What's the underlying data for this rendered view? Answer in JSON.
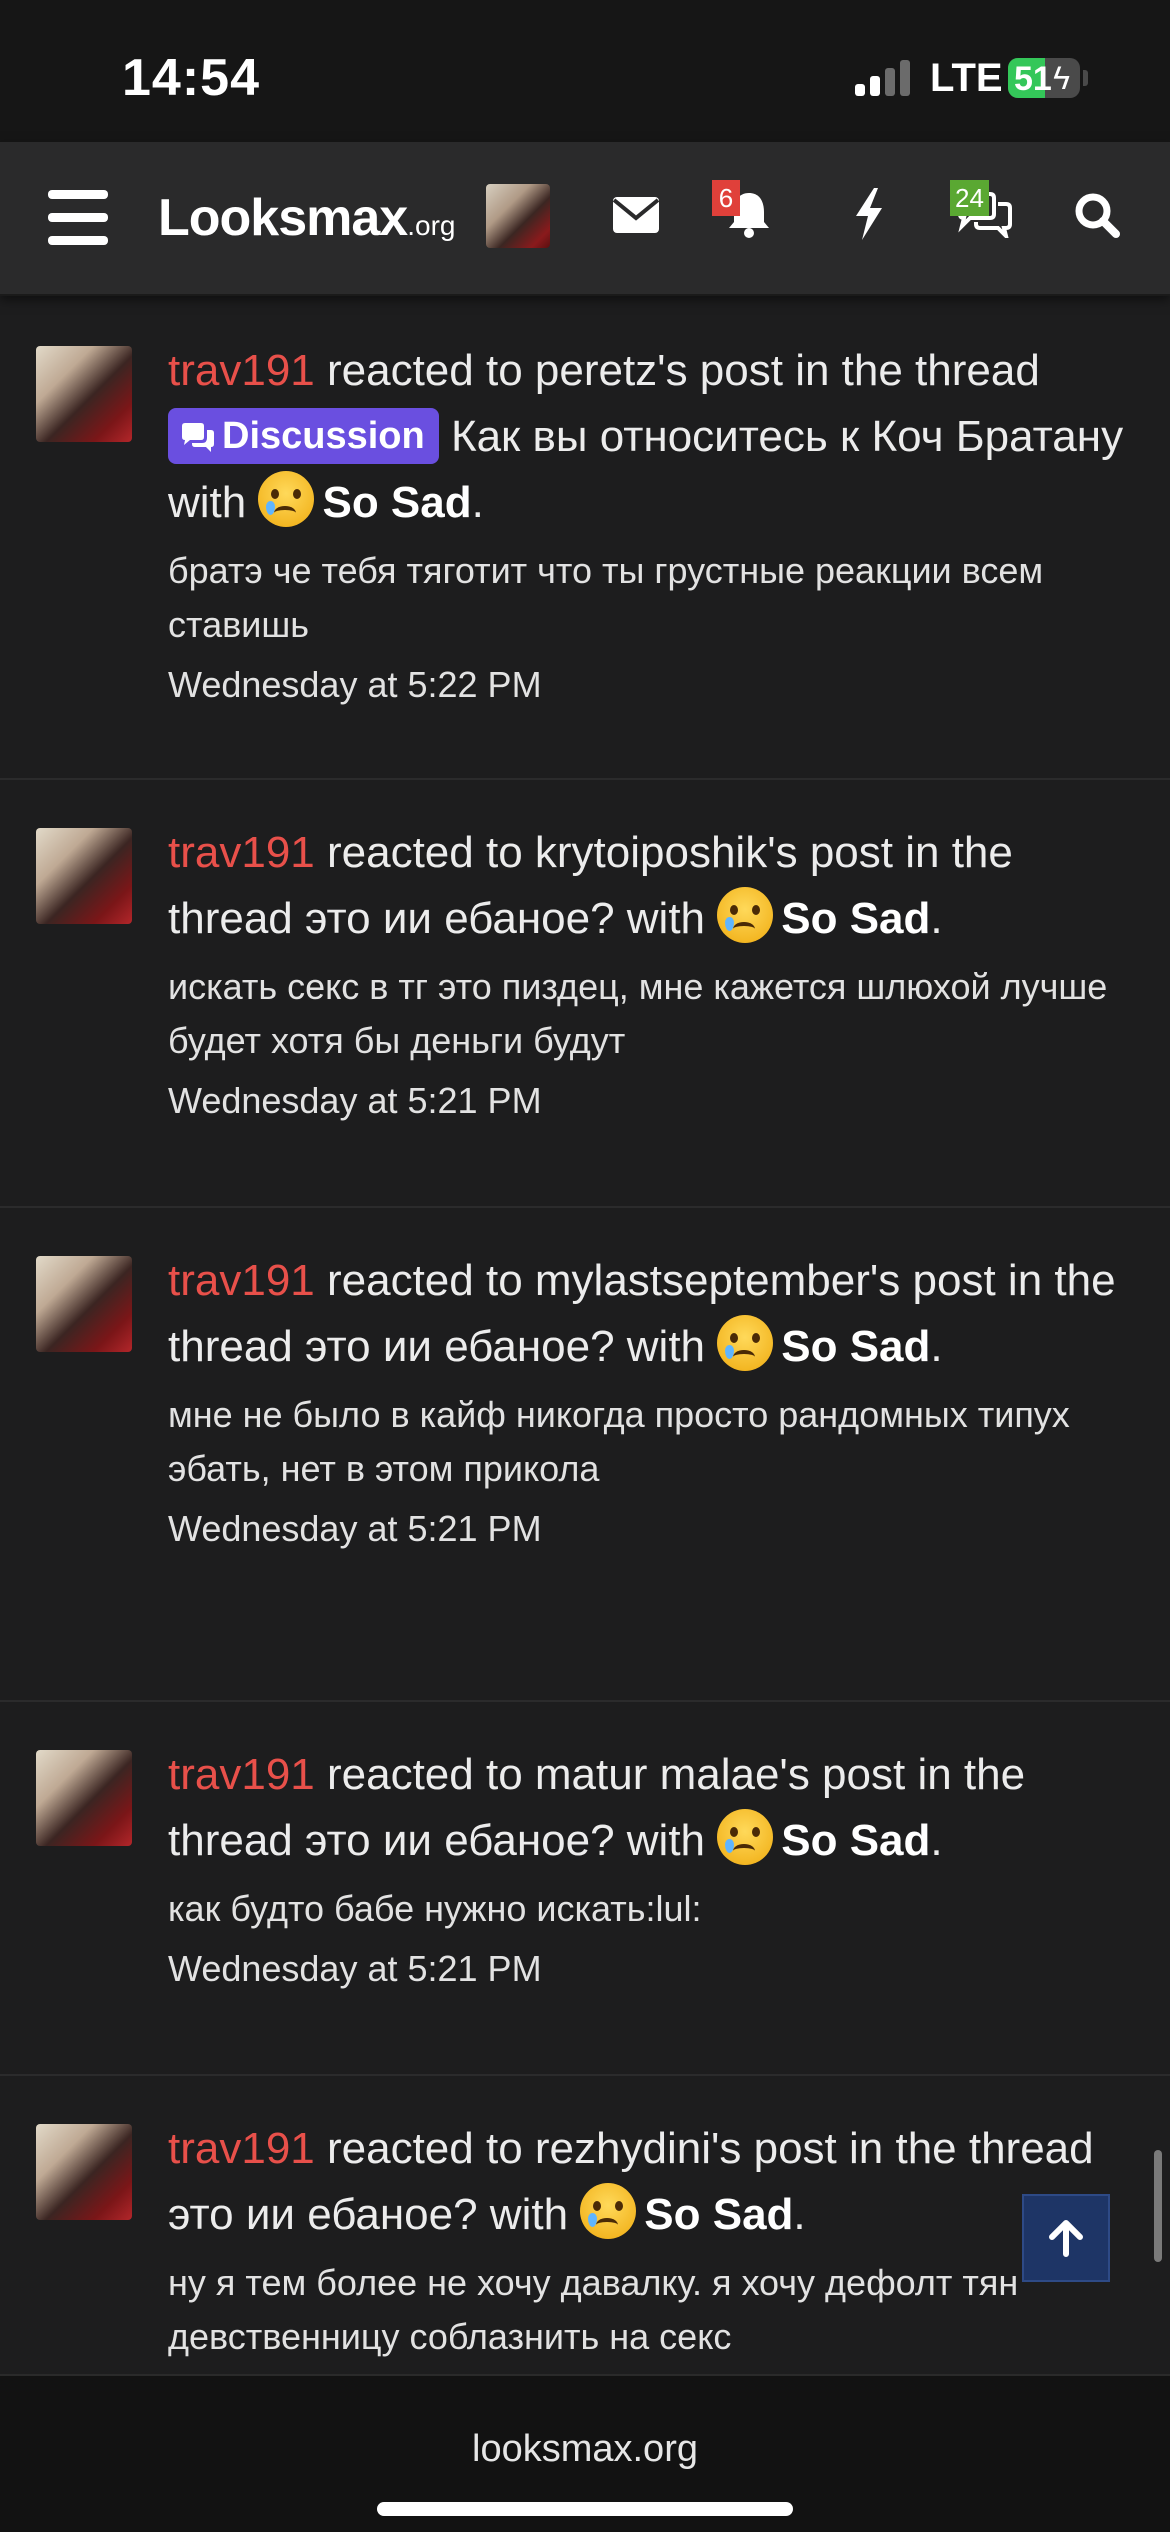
{
  "status": {
    "time": "14:54",
    "network": "LTE",
    "battery": "51",
    "battery_level": 0.51
  },
  "site": {
    "logo_main": "Looksmax",
    "logo_tld": ".org",
    "domain": "looksmax.org"
  },
  "nav": {
    "alerts_count": "6",
    "conversations_count": "24"
  },
  "feed": [
    {
      "user": "trav191",
      "text_before": " reacted to peretz's post in the thread ",
      "tag": "Discussion",
      "text_after": " Как вы относитесь к Коч Братану with ",
      "reaction": "So Sad",
      "snippet": "братэ че тебя тяготит что ты грустные реакции всем ставишь",
      "time": "Wednesday at 5:22 PM"
    },
    {
      "user": "trav191",
      "text_before": " reacted to krytoiposhik's post in the thread это ии ебаное? with ",
      "reaction": "So Sad",
      "snippet": "искать секс в тг это пиздец, мне кажется шлюхой лучше будет хотя бы деньги будут",
      "time": "Wednesday at 5:21 PM"
    },
    {
      "user": "trav191",
      "text_before": " reacted to mylastseptember's post in the thread это ии ебаное? with ",
      "reaction": "So Sad",
      "snippet": "мне не было в кайф никогда просто рандомных типух эбать, нет в этом прикола",
      "time": "Wednesday at 5:21 PM"
    },
    {
      "user": "trav191",
      "text_before": " reacted to matur malae's post in the thread это ии ебаное? with ",
      "reaction": "So Sad",
      "snippet": "как будто бабе нужно искать:lul:",
      "time": "Wednesday at 5:21 PM"
    },
    {
      "user": "trav191",
      "text_before": " reacted to rezhydini's post in the thread это ии ебаное? with ",
      "reaction": "So Sad",
      "snippet": "ну я тем более не хочу давалку. я хочу дефолт тян девственницу соблазнить на секс",
      "time": ""
    }
  ],
  "colors": {
    "username": "#e8504a",
    "tag_bg": "#6a4fe0",
    "alert_badge": "#e0403a",
    "conv_badge": "#5aa832"
  }
}
